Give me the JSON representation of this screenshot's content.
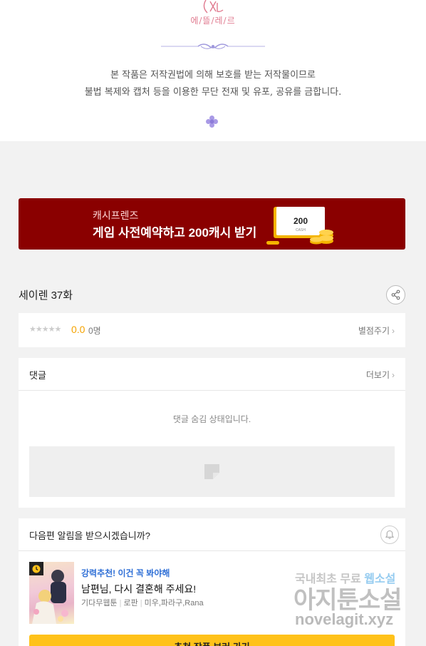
{
  "logo": {
    "sub": "에/뜰/레/르"
  },
  "notice": {
    "line1": "본 작품은 저작권법에 의해 보호를 받는 저작물이므로",
    "line2": "불법 복제와 캡처 등을 이용한 무단 전재 및 유포, 공유를 금합니다."
  },
  "banner": {
    "small": "캐시프렌즈",
    "big": "게임 사전예약하고 200캐시 받기",
    "card_amount": "200",
    "card_label": "CASH"
  },
  "episode": {
    "title": "세이렌 37화"
  },
  "rating": {
    "stars": "★★★★★",
    "score": "0.0",
    "count": "0명",
    "rate_link": "별점주기",
    "chevron": "›"
  },
  "comments": {
    "title": "댓글",
    "more": "더보기",
    "chevron": "›",
    "hidden_notice": "댓글 숨김 상태입니다."
  },
  "next": {
    "title": "다음편 알림을 받으시겠습니까?",
    "rec_label": "강력추천! 이건 꼭 봐야해",
    "rec_title": "남편님, 다시 결혼해 주세요!",
    "rec_meta": [
      "기다무웹툰",
      "로판",
      "미우,파라구,Rana"
    ],
    "button": "추천 작품 보러 가기"
  },
  "watermark": {
    "line1_a": "국내최초 무료 ",
    "line1_b": "웹소설",
    "line2": "아지툰소설",
    "line3": "novelagit.xyz"
  },
  "colors": {
    "banner_bg": "#8a0000",
    "accent_yellow": "#ffc21a",
    "score_orange": "#f5a300",
    "rec_blue": "#2f6fd6"
  }
}
